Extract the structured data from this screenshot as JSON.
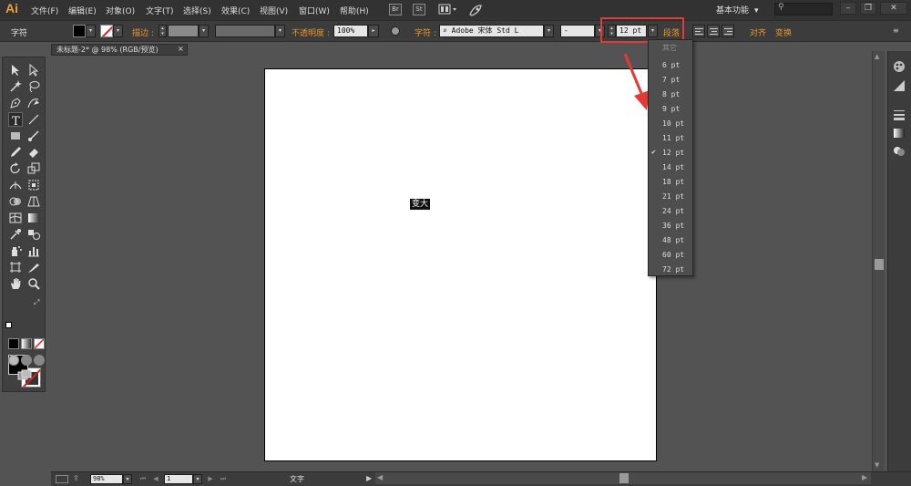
{
  "app": {
    "logo": "Ai"
  },
  "menu": [
    "文件(F)",
    "编辑(E)",
    "对象(O)",
    "文字(T)",
    "选择(S)",
    "效果(C)",
    "视图(V)",
    "窗口(W)",
    "帮助(H)"
  ],
  "menu_buttons": [
    "Br",
    "St"
  ],
  "workspace": "基本功能",
  "window_buttons": [
    "–",
    "❐",
    "✕"
  ],
  "controlbar": {
    "panel_name": "字符",
    "stroke_label": "描边 :",
    "opacity_label": "不透明度 :",
    "opacity_value": "100%",
    "char_label": "字符 :",
    "font_family": "Adobe 宋体 Std L",
    "font_style": "-",
    "font_size": "12 pt",
    "paragraph_label": "段落",
    "align_label": "对齐",
    "transform_label": "变换"
  },
  "document_tab": {
    "title": "未标题-2* @ 98% (RGB/预览)",
    "close": "×"
  },
  "canvas": {
    "selected_text": "变大"
  },
  "font_size_menu": {
    "header": "其它",
    "items": [
      "6 pt",
      "7 pt",
      "8 pt",
      "9 pt",
      "10 pt",
      "11 pt",
      "12 pt",
      "14 pt",
      "18 pt",
      "21 pt",
      "24 pt",
      "36 pt",
      "48 pt",
      "60 pt",
      "72 pt"
    ],
    "selected": "12 pt",
    "checkmark": "✔"
  },
  "statusbar": {
    "zoom": "98%",
    "page": "1",
    "tool": "文字"
  },
  "colors": {
    "annotation_red": "#e53935",
    "accent_orange": "#e8952c"
  }
}
